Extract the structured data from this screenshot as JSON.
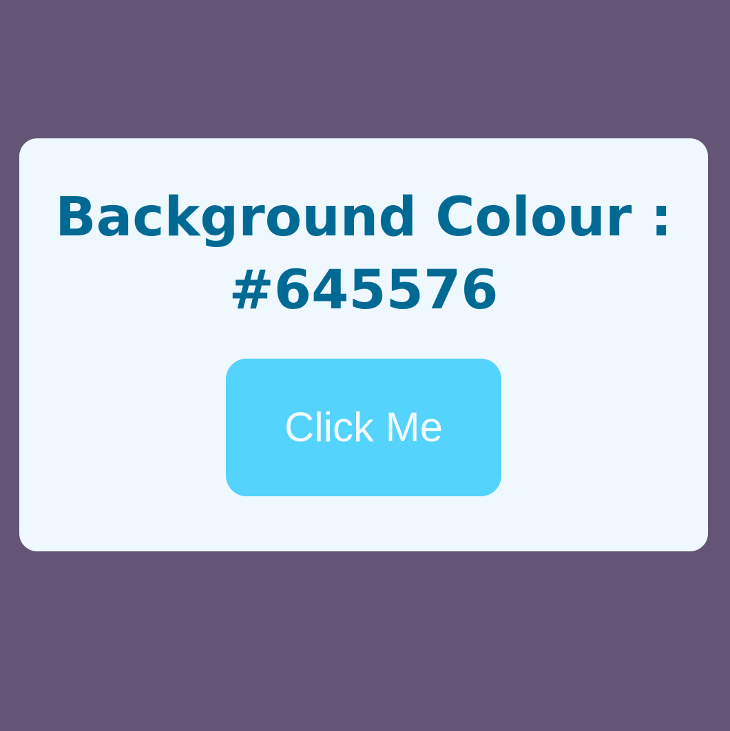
{
  "page": {
    "background_color": "#645576"
  },
  "card": {
    "background_color": "#eff8ff",
    "heading_line1": "Background Colour :",
    "heading_line2": "#645576",
    "heading_color": "#006a95"
  },
  "button": {
    "label": "Click Me",
    "background_color": "#54d3fc",
    "text_color": "#f4fbff"
  }
}
